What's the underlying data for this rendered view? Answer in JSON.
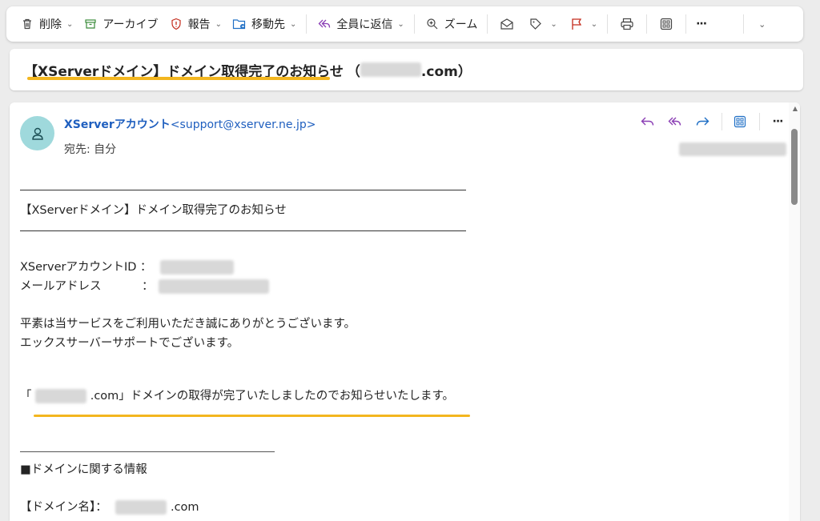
{
  "toolbar": {
    "delete_label": "削除",
    "archive_label": "アーカイブ",
    "report_label": "報告",
    "move_label": "移動先",
    "reply_all_label": "全員に返信",
    "zoom_label": "ズーム",
    "more_label": "···"
  },
  "subject": {
    "text": "【XServerドメイン】ドメイン取得完了のお知らせ",
    "domain_paren_open": "（",
    "domain_suffix": ".com）"
  },
  "message": {
    "sender_name": "XServerアカウント",
    "sender_address": "<support@xserver.ne.jp>",
    "to_label": "宛先:",
    "to_value": "自分",
    "title_line": "【XServerドメイン】ドメイン取得完了のお知らせ",
    "account_id_label": "XServerアカウントID ：",
    "mail_label": "メールアドレス",
    "mail_colon": "：",
    "greeting_1": "平素は当サービスをご利用いただき誠にありがとうございます。",
    "greeting_2": "エックスサーバーサポートでございます。",
    "notice_open": "「",
    "notice_rest": ".com」ドメインの取得が完了いたしましたのでお知らせいたします。",
    "section_title": "■ドメインに関する情報",
    "domain_name_label": "【ドメイン名】：",
    "domain_name_suffix": ".com"
  },
  "colors": {
    "accent_link": "#1f5fbf",
    "highlight": "#f3b61f",
    "avatar_bg": "#9fd9dc",
    "reply_icons": "#8b3fb5"
  }
}
